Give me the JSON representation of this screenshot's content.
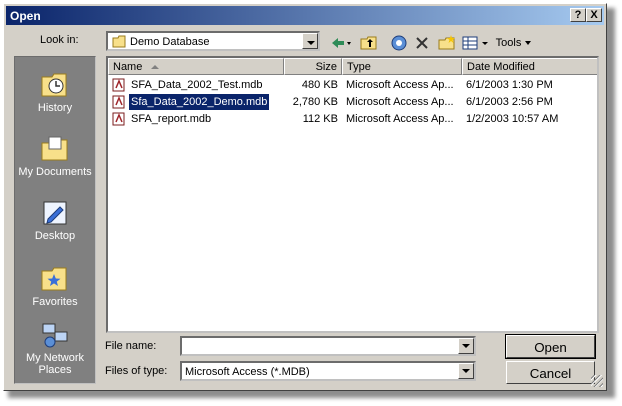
{
  "window": {
    "title": "Open",
    "help_btn": "?",
    "close_btn": "X"
  },
  "lookin": {
    "label": "Look in:",
    "value": "Demo Database"
  },
  "toolbar": {
    "tools_label": "Tools"
  },
  "places": [
    {
      "label": "History"
    },
    {
      "label": "My Documents"
    },
    {
      "label": "Desktop"
    },
    {
      "label": "Favorites"
    },
    {
      "label": "My Network Places"
    }
  ],
  "columns": {
    "name": "Name",
    "size": "Size",
    "type": "Type",
    "date": "Date Modified"
  },
  "files": [
    {
      "name": "SFA_Data_2002_Test.mdb",
      "size": "480 KB",
      "type": "Microsoft Access Ap...",
      "date": "6/1/2003 1:30 PM"
    },
    {
      "name": "Sfa_Data_2002_Demo.mdb",
      "size": "2,780 KB",
      "type": "Microsoft Access Ap...",
      "date": "6/1/2003 2:56 PM"
    },
    {
      "name": "SFA_report.mdb",
      "size": "112 KB",
      "type": "Microsoft Access Ap...",
      "date": "1/2/2003 10:57 AM"
    }
  ],
  "filename": {
    "label": "File name:",
    "value": ""
  },
  "filetype": {
    "label": "Files of type:",
    "value": "Microsoft Access (*.MDB)"
  },
  "buttons": {
    "open": "Open",
    "cancel": "Cancel"
  },
  "colors": {
    "title_start": "#0a246a",
    "title_end": "#a6caf0",
    "face": "#d4d0c8",
    "selection": "#0a246a"
  }
}
